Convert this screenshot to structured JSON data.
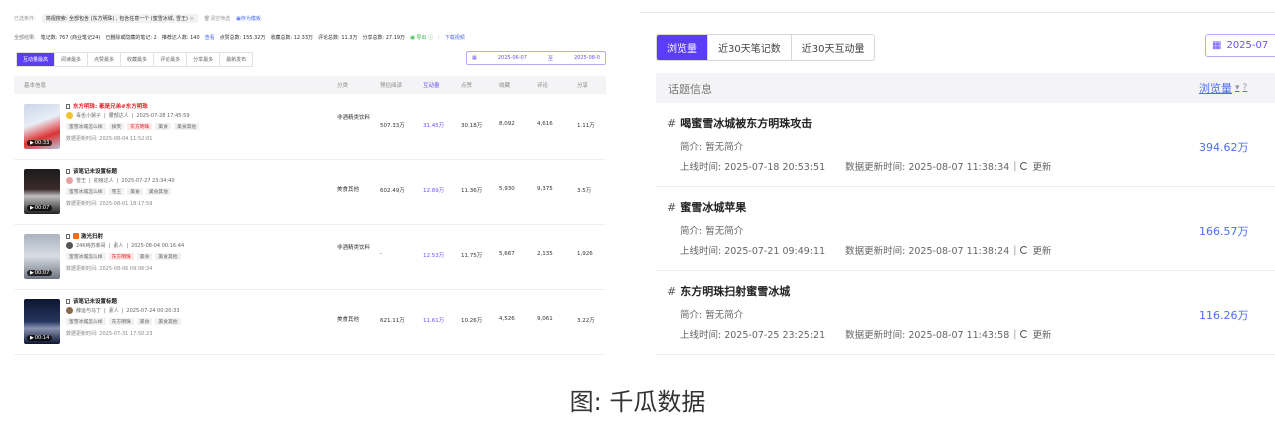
{
  "left": {
    "filter": {
      "label": "已选条件:",
      "chip": "简视搜索: 全部包含 (东方明珠) , 包含任意一个 (蜜雪冰城, 雪王)",
      "clear": "清空筛选",
      "save": "存为模板"
    },
    "result": {
      "label": "全部结果:",
      "notes": "笔记数: 767 (商业笔记24)",
      "reported": "已删除或隐藏的笔记: 2",
      "authors_prefix": "推荐达人数: 140",
      "view_link": "查看",
      "likes": "点赞总数: 155.32万",
      "collects": "收藏总数: 12.33万",
      "comments": "评论总数: 11.3万",
      "shares": "分享总数: 27.19万",
      "export": "导出",
      "download": "下载视频"
    },
    "tabs": [
      "互动量最高",
      "阅读最多",
      "点赞最多",
      "收藏最多",
      "评论最多",
      "分享最多",
      "最新发布"
    ],
    "date_range": {
      "start": "2025-06-07",
      "sep": "至",
      "end": "2025-08-0"
    },
    "columns": [
      "基本信息",
      "分类",
      "预估阅读",
      "互动量",
      "点赞",
      "收藏",
      "评论",
      "分享"
    ],
    "rows": [
      {
        "title_red": "东方明珠: 都是兄弟#东方明珠",
        "author": "毒舌小舅子",
        "level": "腰部达人",
        "published": "2025-07-28 17:45:59",
        "tags": [
          "蜜雪冰城怎么样",
          "搞笑",
          "东方明珠",
          "美食",
          "美食其他"
        ],
        "hot_tag_index": 2,
        "updated": "数据更新时间: 2025-08-04 11:52:01",
        "duration": "00:33",
        "category": "非酒精类饮料",
        "reads": "507.33万",
        "interaction": "31.45万",
        "likes": "30.18万",
        "collects": "8,092",
        "comments": "4,616",
        "shares": "1.11万"
      },
      {
        "title": "该笔记未设置标题",
        "author": "雪王",
        "level": "初级达人",
        "published": "2025-07-27 23:34:40",
        "tags": [
          "蜜雪冰城怎么样",
          "雪王",
          "美食",
          "美食其他"
        ],
        "hot_tag_index": -1,
        "updated": "数据更新时间: 2025-08-01 18:17:59",
        "duration": "00:07",
        "category": "美食其他",
        "reads": "602.49万",
        "interaction": "12.89万",
        "likes": "11.36万",
        "collects": "5,930",
        "comments": "9,375",
        "shares": "3.5万"
      },
      {
        "title": "激光扫射",
        "author": "24K纯苏菲哥",
        "level": "素人",
        "published": "2025-08-04 00:16:44",
        "tags": [
          "蜜雪冰城怎么样",
          "东方明珠",
          "美食",
          "美食其他"
        ],
        "hot_tag_index": 1,
        "updated": "数据更新时间: 2025-08-06 09:06:34",
        "duration": "00:07",
        "category": "非酒精类饮料",
        "reads": "-",
        "interaction": "12.53万",
        "likes": "11.75万",
        "collects": "5,667",
        "comments": "2,135",
        "shares": "1,926"
      },
      {
        "title": "该笔记未设置标题",
        "author": "薛运与马丁",
        "level": "素人",
        "published": "2025-07-24 00:20:33",
        "tags": [
          "蜜雪冰城怎么样",
          "东方明珠",
          "美食",
          "美食其他"
        ],
        "hot_tag_index": -1,
        "updated": "数据更新时间: 2025-07-31 17:50:23",
        "duration": "00:14",
        "category": "美食其他",
        "reads": "621.11万",
        "interaction": "11.61万",
        "likes": "10.26万",
        "collects": "4,526",
        "comments": "9,061",
        "shares": "3.22万"
      }
    ]
  },
  "right": {
    "tabs": [
      "浏览量",
      "近30天笔记数",
      "近30天互动量"
    ],
    "date": "2025-07",
    "header": {
      "left": "话题信息",
      "right": "浏览量"
    },
    "topics": [
      {
        "hash": "#",
        "name": "喝蜜雪冰城被东方明珠攻击",
        "intro": "简介: 暂无简介",
        "online": "上线时间: 2025-07-18 20:53:51",
        "updated": "数据更新时间: 2025-08-07 11:38:34",
        "refresh": "更新",
        "views": "394.62万"
      },
      {
        "hash": "#",
        "name": "蜜雪冰城苹果",
        "intro": "简介: 暂无简介",
        "online": "上线时间: 2025-07-21 09:49:11",
        "updated": "数据更新时间: 2025-08-07 11:38:24",
        "refresh": "更新",
        "views": "166.57万"
      },
      {
        "hash": "#",
        "name": "东方明珠扫射蜜雪冰城",
        "intro": "简介: 暂无简介",
        "online": "上线时间: 2025-07-25 23:25:21",
        "updated": "数据更新时间: 2025-08-07 11:43:58",
        "refresh": "更新",
        "views": "116.26万"
      }
    ]
  },
  "caption": "图: 千瓜数据",
  "colors": {
    "accent": "#5b3df5",
    "link": "#4a6cf7",
    "hot": "#e0232c"
  }
}
